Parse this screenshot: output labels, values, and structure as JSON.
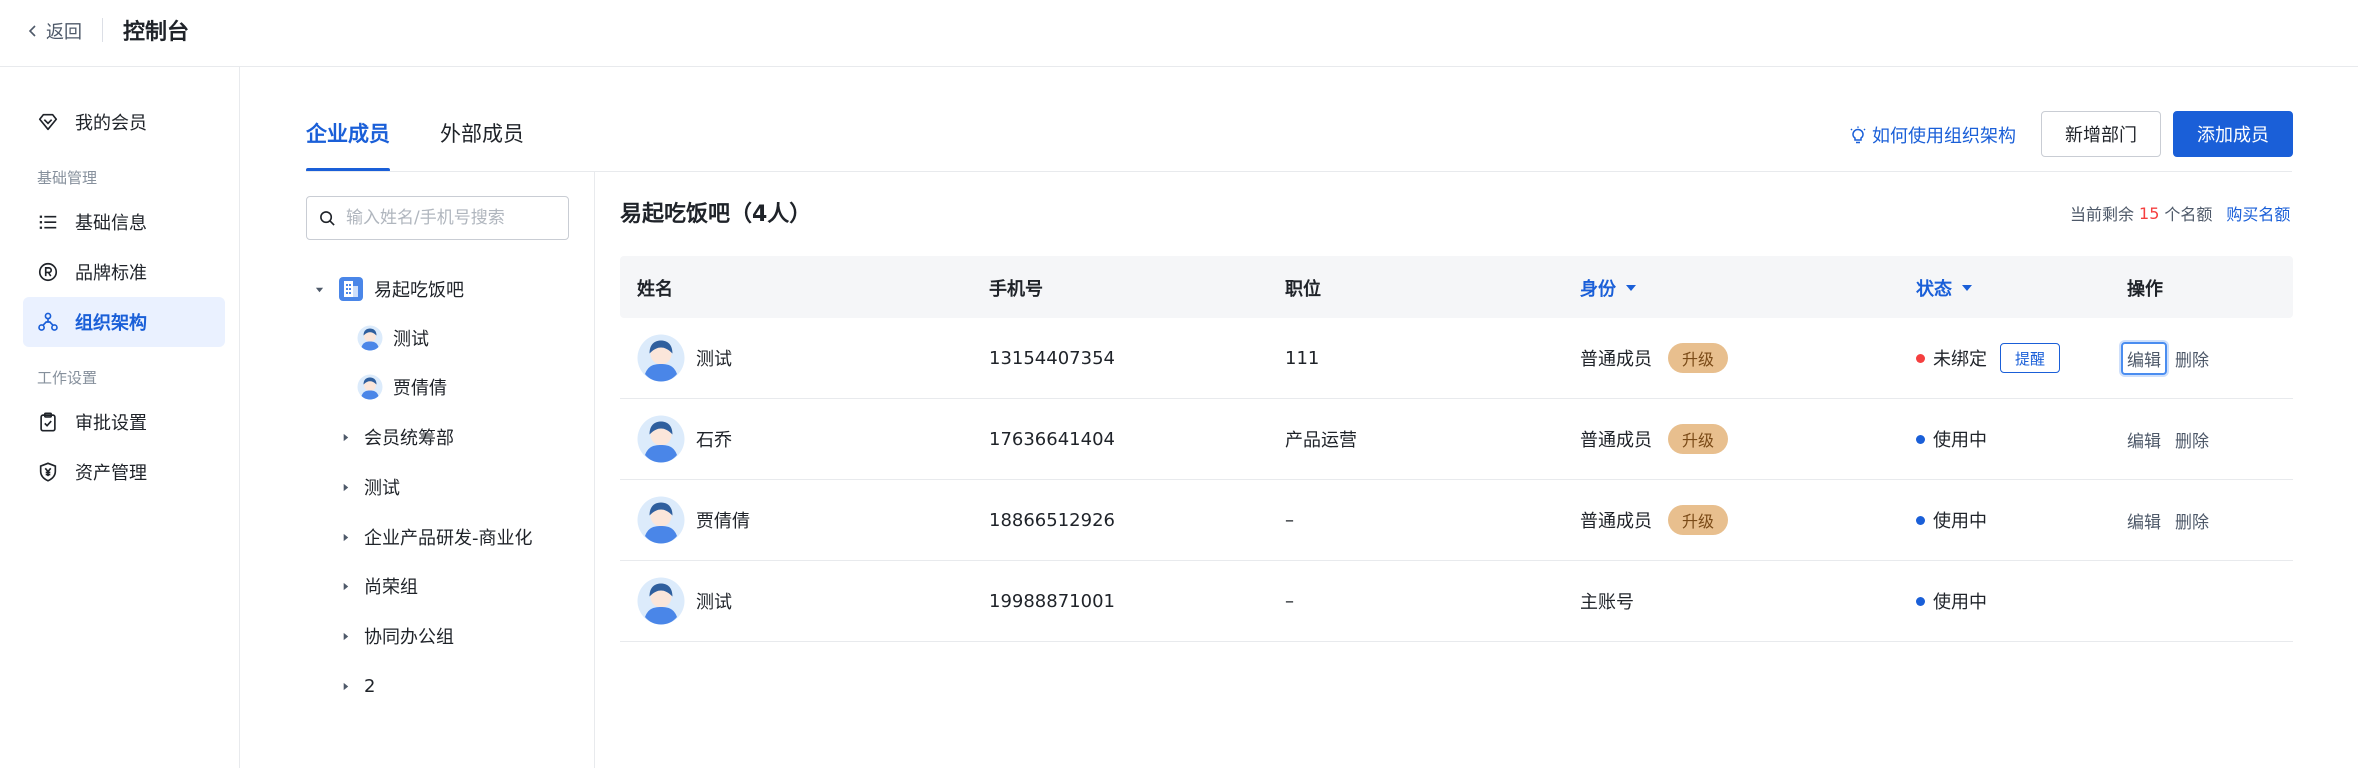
{
  "topbar": {
    "back_label": "返回",
    "title": "控制台"
  },
  "sidebar": {
    "top_item": {
      "label": "我的会员",
      "icon": "diamond-icon"
    },
    "groups": [
      {
        "title": "基础管理",
        "items": [
          {
            "label": "基础信息",
            "icon": "list-icon"
          },
          {
            "label": "品牌标准",
            "icon": "registered-icon"
          },
          {
            "label": "组织架构",
            "icon": "org-chart-icon",
            "active": true
          }
        ]
      },
      {
        "title": "工作设置",
        "items": [
          {
            "label": "审批设置",
            "icon": "clipboard-check-icon"
          },
          {
            "label": "资产管理",
            "icon": "yen-shield-icon"
          }
        ]
      }
    ]
  },
  "tabs": [
    {
      "label": "企业成员",
      "active": true
    },
    {
      "label": "外部成员",
      "active": false
    }
  ],
  "toolbar": {
    "help_link": "如何使用组织架构",
    "add_dept": "新增部门",
    "add_member": "添加成员"
  },
  "search": {
    "placeholder": "输入姓名/手机号搜索"
  },
  "tree": {
    "root": "易起吃饭吧",
    "members": [
      "测试",
      "贾倩倩"
    ],
    "departments": [
      "会员统筹部",
      "测试",
      "企业产品研发-商业化",
      "尚荣组",
      "协同办公组",
      "2"
    ]
  },
  "content": {
    "dept_title": "易起吃饭吧（4人）",
    "quota_prefix": "当前剩余",
    "quota_num": "15",
    "quota_suffix": "个名额",
    "buy_label": "购买名额"
  },
  "table": {
    "headers": {
      "name": "姓名",
      "phone": "手机号",
      "position": "职位",
      "identity": "身份",
      "status": "状态",
      "actions": "操作"
    },
    "upgrade_label": "升级",
    "remind_label": "提醒",
    "edit_label": "编辑",
    "delete_label": "删除",
    "rows": [
      {
        "name": "测试",
        "phone": "13154407354",
        "position": "111",
        "identity": "普通成员",
        "status": "未绑定"
      },
      {
        "name": "石乔",
        "phone": "17636641404",
        "position": "产品运营",
        "identity": "普通成员",
        "status": "使用中"
      },
      {
        "name": "贾倩倩",
        "phone": "18866512926",
        "position": "–",
        "identity": "普通成员",
        "status": "使用中"
      },
      {
        "name": "测试",
        "phone": "19988871001",
        "position": "–",
        "identity": "主账号",
        "status": "使用中"
      }
    ]
  },
  "colors": {
    "primary": "#1a5fd8",
    "upgrade_badge": "#e8bf8e",
    "status_unbound": "#f53f3f",
    "status_active": "#1a5fd8"
  }
}
